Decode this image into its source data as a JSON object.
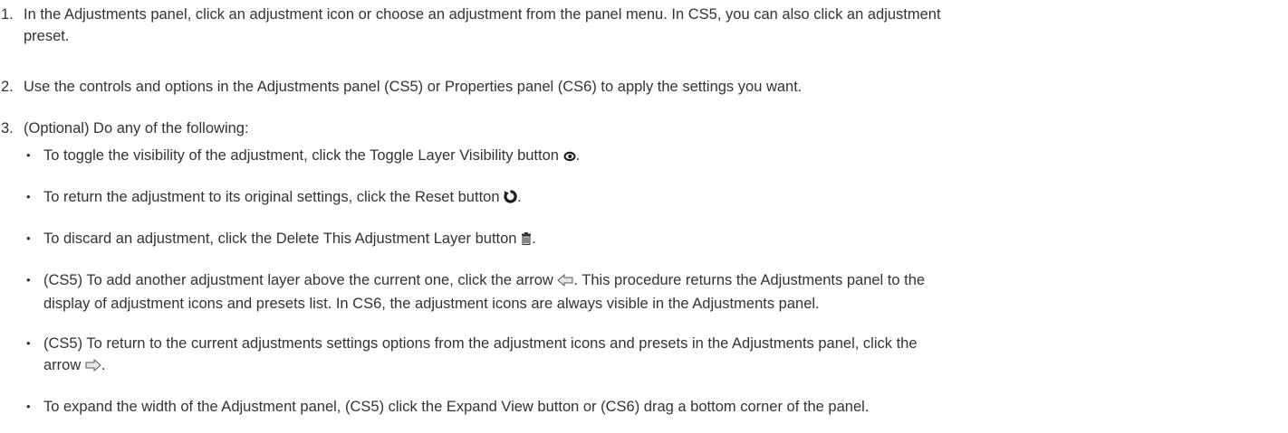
{
  "steps": [
    {
      "number": "1.",
      "text_line1": "In the Adjustments panel, click an adjustment icon or choose an adjustment from the panel menu. In CS5, you can also click an adjustment",
      "text_line2": "preset."
    },
    {
      "number": "2.",
      "text": "Use the controls and options in the Adjustments panel (CS5) or Properties panel (CS6) to apply the settings you want."
    },
    {
      "number": "3.",
      "text": "(Optional) Do any of the following:"
    }
  ],
  "bullets": [
    {
      "marker": "•",
      "text_before": "To toggle the visibility of the adjustment, click the Toggle Layer Visibility button ",
      "icon": "eye-icon",
      "text_after": "."
    },
    {
      "marker": "•",
      "text_before": "To return the adjustment to its original settings, click the Reset button ",
      "icon": "reset-icon",
      "text_after": "."
    },
    {
      "marker": "•",
      "text_before": "To discard an adjustment, click the Delete This Adjustment Layer button ",
      "icon": "trash-icon",
      "text_after": "."
    },
    {
      "marker": "•",
      "text_before": "(CS5) To add another adjustment layer above the current one, click the arrow ",
      "icon": "arrow-left-icon",
      "text_after": ". This procedure returns the Adjustments panel to the",
      "text_line2": "display of adjustment icons and presets list. In CS6, the adjustment icons are always visible in the Adjustments panel."
    },
    {
      "marker": "•",
      "text_before": "(CS5) To return to the current adjustments settings options from the adjustment icons and presets in the Adjustments panel, click the",
      "text_line2_before": "arrow ",
      "icon": "arrow-right-icon",
      "text_after": "."
    },
    {
      "marker": "•",
      "text_before": "To expand the width of the Adjustment panel, (CS5) click the Expand View button or (CS6) drag a bottom corner of the panel."
    }
  ]
}
